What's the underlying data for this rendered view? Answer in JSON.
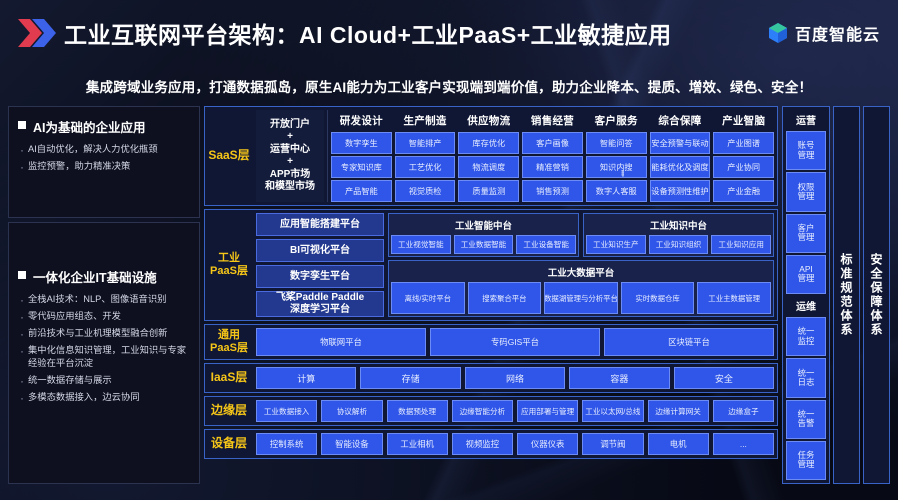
{
  "header": {
    "title": "工业互联网平台架构：AI Cloud+工业PaaS+工业敏捷应用",
    "brand": "百度智能云",
    "subtitle": "集成跨域业务应用，打通数据孤岛，原生AI能力为工业客户实现端到端价值，助力企业降本、提质、增效、绿色、安全！"
  },
  "left": {
    "card1": {
      "title": "AI为基础的企业应用",
      "items": [
        "AI自动优化，解决人力优化瓶颈",
        "监控预警，助力精准决策"
      ]
    },
    "card2": {
      "title": "一体化企业IT基础设施",
      "items": [
        "全栈AI技术：NLP、图像语音识别",
        "零代码应用组态、开发",
        "前沿技术与工业机理模型融合创新",
        "集中化信息知识管理，工业知识与专家经验在平台沉淀",
        "统一数据存储与展示",
        "多模态数据接入，边云协同"
      ]
    }
  },
  "layers": {
    "saas": {
      "label": "SaaS层",
      "portal": "开放门户\n+\n运营中心\n+\nAPP市场\n和模型市场",
      "columns": [
        {
          "head": "研发设计",
          "cells": [
            "数字孪生",
            "专家知识库",
            "产品智能"
          ]
        },
        {
          "head": "生产制造",
          "cells": [
            "智能排产",
            "工艺优化",
            "视觉质检"
          ]
        },
        {
          "head": "供应物流",
          "cells": [
            "库存优化",
            "物流调度",
            "质量监测"
          ]
        },
        {
          "head": "销售经营",
          "cells": [
            "客户画像",
            "精准营销",
            "销售预测"
          ]
        },
        {
          "head": "客户服务",
          "cells": [
            "智能问答",
            "知识内ููู搜",
            "数字人客服"
          ]
        },
        {
          "head": "综合保障",
          "cells": [
            "安全预警与联动",
            "能耗优化及调度",
            "设备预测性维护"
          ]
        },
        {
          "head": "产业智脑",
          "cells": [
            "产业图谱",
            "产业协同",
            "产业金融"
          ]
        }
      ]
    },
    "ipaas": {
      "label": "工业\nPaaS层",
      "left_cells": [
        "应用智能搭建平台",
        "BI可视化平台",
        "数字孪生平台",
        "飞桨Paddle Paddle\n深度学习平台"
      ],
      "panels": [
        {
          "head": "工业智能中台",
          "cells": [
            "工业视觉智能",
            "工业数据智能",
            "工业设备智能"
          ]
        },
        {
          "head": "工业知识中台",
          "cells": [
            "工业知识生产",
            "工业知识组织",
            "工业知识应用"
          ]
        }
      ],
      "bigdata": {
        "head": "工业大数据平台",
        "cells": [
          "离线/实时平台",
          "搜索聚合平台",
          "数据湖管理与分析平台",
          "实时数据仓库",
          "工业主数据管理"
        ]
      }
    },
    "gpaas": {
      "label": "通用\nPaaS层",
      "cells": [
        "物联网平台",
        "专码GIS平台",
        "区块链平台"
      ]
    },
    "iaas": {
      "label": "IaaS层",
      "cells": [
        "计算",
        "存储",
        "网络",
        "容器",
        "安全"
      ]
    },
    "edge": {
      "label": "边缘层",
      "cells": [
        "工业数据接入",
        "协议解析",
        "数据预处理",
        "边缘智能分析",
        "应用部署与管理",
        "工业以太网/总线",
        "边缘计算网关",
        "边缘盒子"
      ]
    },
    "device": {
      "label": "设备层",
      "cells": [
        "控制系统",
        "智能设备",
        "工业相机",
        "视频监控",
        "仪器仪表",
        "调节阀",
        "电机",
        "..."
      ]
    }
  },
  "right": {
    "ops": {
      "head1": "运营",
      "cells1": [
        "账号\n管理",
        "权限\n管理",
        "客户\n管理",
        "API\n管理"
      ],
      "head2": "运维",
      "cells2": [
        "统一\n监控",
        "统一\n日志",
        "统一\n告警",
        "任务\n管理"
      ]
    },
    "vertical1": "标准规范体系",
    "vertical2": "安全保障体系"
  },
  "colors": {
    "accent_yellow": "#f5c518",
    "cell_blue": "#2f56e8",
    "panel_border": "#3a63c8",
    "bg_dark": "#070a15"
  }
}
